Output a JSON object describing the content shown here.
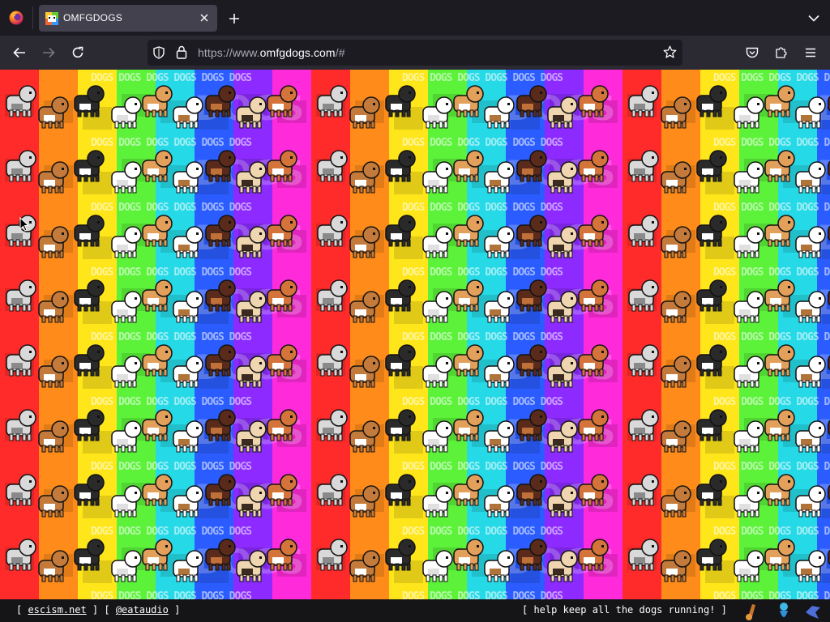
{
  "browser": {
    "tab": {
      "title": "OMFGDOGS"
    },
    "url": {
      "prefix": "https://www.",
      "host": "omfgdogs.com",
      "path": "/#"
    }
  },
  "page": {
    "background_word": "DOGS",
    "stripe_colors": [
      "#ff2a2a",
      "#ff8c1a",
      "#ffe61a",
      "#5cf23a",
      "#26d9e6",
      "#2a5cff",
      "#8c2aff",
      "#ff2ad9"
    ],
    "footer": {
      "left_open_1": "[ ",
      "link_1": "escism.net",
      "left_sep": " ] [ ",
      "link_2": "@eataudio",
      "left_close": " ]",
      "right_open": "[ ",
      "right_link": "help keep all the dogs running!",
      "right_close": " ]"
    }
  },
  "icons": {
    "firefox": "firefox-logo-icon",
    "back": "arrow-left-icon",
    "forward": "arrow-right-icon",
    "reload": "reload-icon",
    "shield": "tracking-shield-icon",
    "lock": "lock-icon",
    "bookmark": "star-icon",
    "pocket": "pocket-icon",
    "extensions": "puzzle-icon",
    "menu": "hamburger-menu-icon"
  }
}
